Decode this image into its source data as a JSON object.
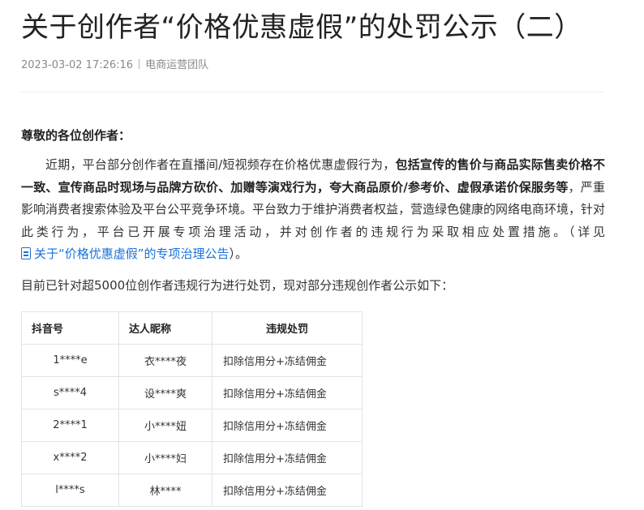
{
  "article": {
    "title": "关于创作者“价格优惠虚假”的处罚公示（二）",
    "date": "2023-03-02 17:26:16",
    "author": "电商运营团队",
    "greeting": "尊敬的各位创作者：",
    "p1": {
      "t1": "近期，平台部分创作者在直播间/短视频存在价格优惠虚假行为，",
      "b1": "包括宣传的售价与商品实际售卖价格不一致、宣传商品时现场与品牌方砍价、加赠等演戏行为，",
      "t2": "夸大商品原价/参考价、虚假承诺价保服务等",
      "t3": "，严重影响消费者搜索体验及平台公平竞争环境。平台致力于维护消费者权益，营造绿色健康的网络电商环境，针对此类行为，平台已开展专项治理活动，并对创作者的违规行为采取相应处置措施。（详见 ",
      "link": "关于“价格优惠虚假”的专项治理公告",
      "t4": "）。"
    },
    "p2": "目前已针对超5000位创作者违规行为进行处罚，现对部分违规创作者公示如下：",
    "table": {
      "headers": [
        "抖音号",
        "达人昵称",
        "违规处罚"
      ],
      "rows": [
        [
          "1****e",
          "衣****夜",
          "扣除信用分+冻结佣金"
        ],
        [
          "s****4",
          "设****爽",
          "扣除信用分+冻结佣金"
        ],
        [
          "2****1",
          "小****妞",
          "扣除信用分+冻结佣金"
        ],
        [
          "x****2",
          "小****妇",
          "扣除信用分+冻结佣金"
        ],
        [
          "l****s",
          "林****",
          "扣除信用分+冻结佣金"
        ]
      ]
    }
  },
  "colors": {
    "link": "#1a73d9",
    "text": "#333333",
    "meta": "#8a8a8a",
    "border": "#e3e3e3"
  }
}
